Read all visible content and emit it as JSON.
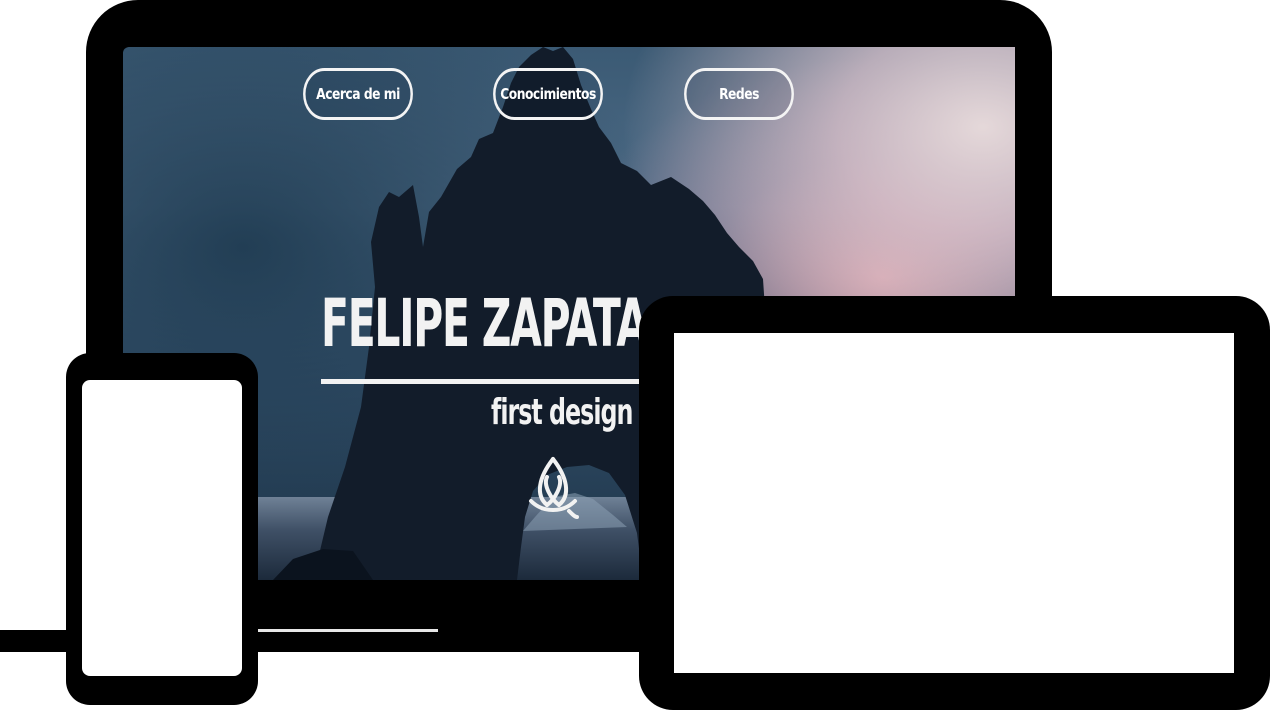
{
  "nav": {
    "items": [
      {
        "label": "Acerca de mi"
      },
      {
        "label": "Conocimientos"
      },
      {
        "label": "Redes"
      }
    ]
  },
  "hero": {
    "title": "FELIPE ZAPATA S",
    "subtitle": "first design",
    "emblem_icon": "triquetra-icon"
  },
  "colors": {
    "text": "#f2f2f2",
    "device_frame": "#000000",
    "device_screen": "#ffffff"
  }
}
